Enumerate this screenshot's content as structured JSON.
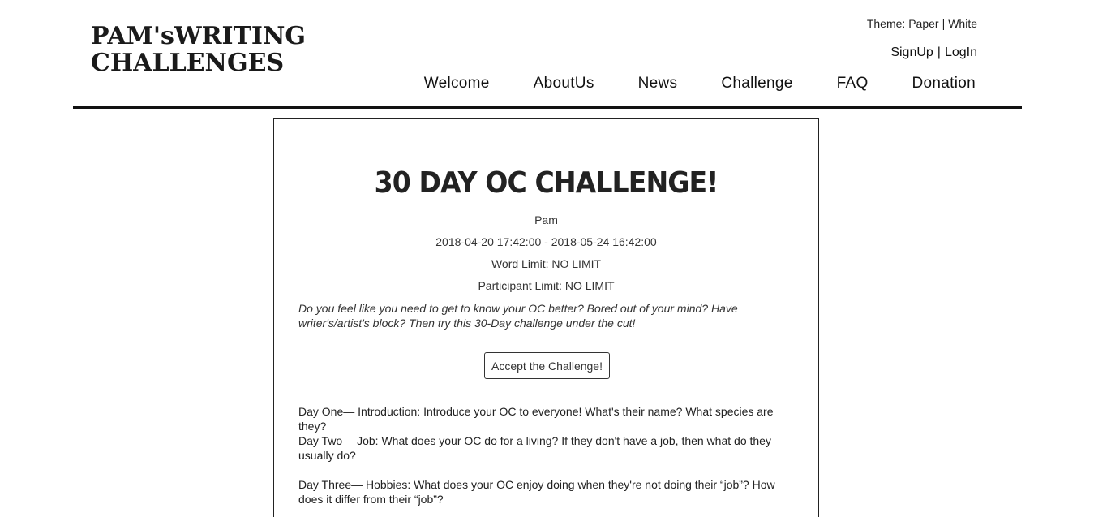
{
  "header": {
    "logo_line1": "PAM'sWRITING",
    "logo_line2": "CHALLENGES",
    "theme_label": "Theme:",
    "theme_options": [
      "Paper",
      "White"
    ],
    "auth": {
      "signup": "SignUp",
      "login": "LogIn"
    },
    "nav": [
      "Welcome",
      "AboutUs",
      "News",
      "Challenge",
      "FAQ",
      "Donation"
    ]
  },
  "challenge": {
    "title": "30 DAY OC CHALLENGE!",
    "author": "Pam",
    "dates": "2018-04-20 17:42:00 - 2018-05-24 16:42:00",
    "word_limit": "Word Limit: NO LIMIT",
    "participant_limit": "Participant Limit: NO LIMIT",
    "intro": "Do you feel like you need to get to know your OC better? Bored out of your mind? Have writer's/artist's block? Then try this 30-Day challenge under the cut!",
    "accept_label": "Accept the Challenge!",
    "days": [
      "Day One— Introduction: Introduce your OC to everyone! What's their name? What species are they?",
      "Day Two— Job: What does your OC do for a living? If they don't have a job, then what do they usually do?",
      "Day Three— Hobbies: What does your OC enjoy doing when they're not doing their “job”? How does it differ from their “job”?"
    ]
  },
  "colors": {
    "text": "#222222",
    "rule": "#111111",
    "background": "#ffffff"
  }
}
